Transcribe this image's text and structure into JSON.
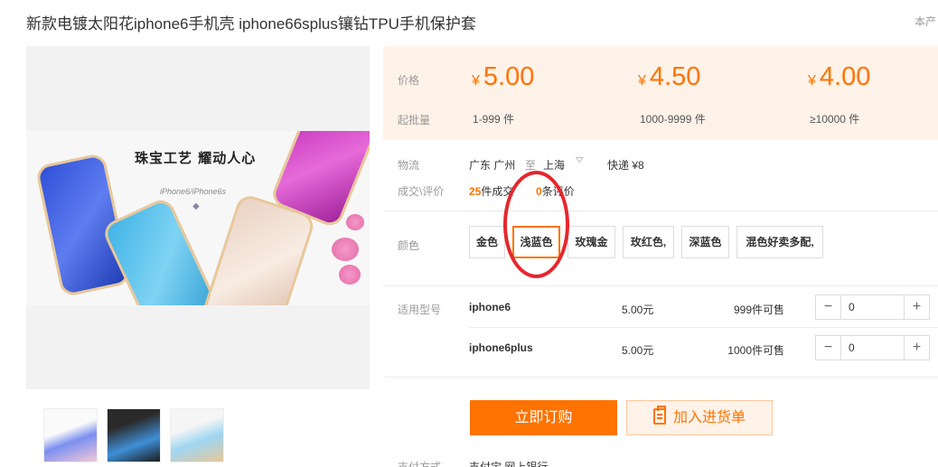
{
  "title": "新款电镀太阳花iphone6手机壳 iphone66splus镶钻TPU手机保护套",
  "top_right_text": "本产",
  "banner": {
    "headline": "珠宝工艺 耀动人心",
    "subtitle": "iPhone6/iPhone6s"
  },
  "price": {
    "label": "价格",
    "min_order_label": "起批量",
    "currency": "¥",
    "tiers": [
      {
        "price": "5.00",
        "quantity": "1-999 件"
      },
      {
        "price": "4.50",
        "quantity": "1000-9999 件"
      },
      {
        "price": "4.00",
        "quantity": "≥10000 件"
      }
    ]
  },
  "logistics": {
    "label": "物流",
    "from": "广东 广州",
    "to_word": "至",
    "to": "上海",
    "shipping": "快递 ¥8"
  },
  "deals": {
    "label": "成交\\评价",
    "count": "25",
    "count_suffix": "件成交",
    "reviews": "0",
    "reviews_suffix": "条评价"
  },
  "color": {
    "label": "颜色",
    "options": [
      "金色",
      "浅蓝色",
      "玫瑰金",
      "玫红色,",
      "深蓝色",
      "混色好卖多配,"
    ],
    "selected": "浅蓝色"
  },
  "models": {
    "label": "适用型号",
    "rows": [
      {
        "name": "iphone6",
        "price": "5.00元",
        "stock": "999件可售",
        "qty": "0"
      },
      {
        "name": "iphone6plus",
        "price": "5.00元",
        "stock": "1000件可售",
        "qty": "0"
      }
    ]
  },
  "actions": {
    "buy_now": "立即订购",
    "add_to_cart": "加入进货单"
  },
  "footer_partial": {
    "label": "支付方式",
    "value": "支付宝 网上银行"
  },
  "colors": {
    "accent": "#ff7300",
    "price_bg": "#fff2e8",
    "highlight_circle": "#e6262d"
  },
  "icons": {
    "cart": "clipboard-list-icon",
    "chevron": "chevron-down-icon",
    "minus": "minus-icon",
    "plus": "plus-icon"
  }
}
